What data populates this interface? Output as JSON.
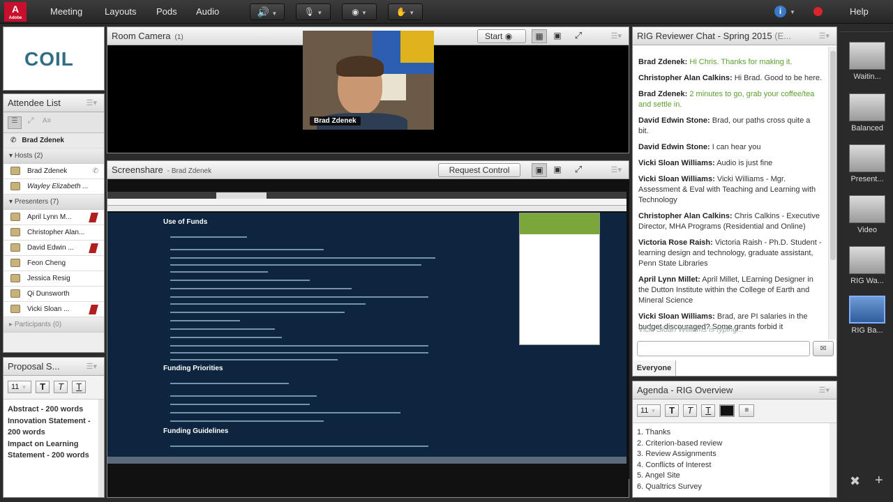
{
  "menubar": {
    "app_logo": "Adobe",
    "items": [
      "Meeting",
      "Layouts",
      "Pods",
      "Audio"
    ],
    "help": "Help"
  },
  "logo_pod": {
    "text": "COIL"
  },
  "attendee": {
    "title": "Attendee List",
    "current_user": "Brad Zdenek",
    "hosts_label": "Hosts (2)",
    "hosts": [
      "Brad Zdenek",
      "Wayley Elizabeth ..."
    ],
    "presenters_label": "Presenters (7)",
    "presenters": [
      "April Lynn M...",
      "Christopher Alan...",
      "David Edwin ...",
      "Feon Cheng",
      "Jessica Resig",
      "Qi Dunsworth",
      "Vicki Sloan ..."
    ],
    "participants_label": "Participants (0)"
  },
  "proposal": {
    "title": "Proposal S...",
    "font_size": "11",
    "text": [
      "Abstract - 200 words",
      "Innovation Statement - 200 words",
      "Impact on Learning Statement - 200 words"
    ]
  },
  "camera": {
    "title": "Room Camera",
    "count": "(1)",
    "start_label": "Start",
    "name_tag": "Brad Zdenek"
  },
  "screenshare": {
    "title": "Screenshare",
    "presenter": "- Brad Zdenek",
    "request_label": "Request Control",
    "doc": {
      "h1": "Use of Funds",
      "h2": "Funding Priorities",
      "h3": "Funding Guidelines"
    }
  },
  "chat": {
    "title": "RIG Reviewer Chat - Spring 2015",
    "title_suffix": "(E...",
    "messages": [
      {
        "name": "Brad Zdenek:",
        "text": "Hi Chris. Thanks for making it.",
        "green": true
      },
      {
        "name": "Christopher Alan Calkins:",
        "text": "Hi Brad.  Good to be here.",
        "green": false
      },
      {
        "name": "Brad Zdenek:",
        "text": "2 minutes to go, grab your coffee/tea and settle in.",
        "green": true
      },
      {
        "name": "David Edwin Stone:",
        "text": "Brad, our paths cross quite a bit.",
        "green": false
      },
      {
        "name": "David Edwin Stone:",
        "text": "I can hear you",
        "green": false
      },
      {
        "name": "Vicki Sloan Williams:",
        "text": "Audio is just fine",
        "green": false
      },
      {
        "name": "Vicki Sloan Williams:",
        "text": "Vicki Williams - Mgr. Assessment & Eval with Teaching and Learning with Technology",
        "green": false
      },
      {
        "name": "Christopher Alan Calkins:",
        "text": "Chris Calkins - Executive Director, MHA Programs (Residential and Online)",
        "green": false
      },
      {
        "name": "Victoria Rose Raish:",
        "text": "Victoria Raish - Ph.D. Student - learning design and technology, graduate assistant, Penn State Libraries",
        "green": false
      },
      {
        "name": "April Lynn Millet:",
        "text": "April Millet, LEarning Designer in the Dutton Institute within the College of Earth and Mineral Science",
        "green": false
      },
      {
        "name": "Vicki Sloan Williams:",
        "text": "Brad, are PI salaries in the budget discouraged? Some grants forbid it",
        "green": false
      }
    ],
    "typing": "Vicki Sloan Williams is typing...",
    "input_value": "",
    "recipient": "Everyone"
  },
  "agenda": {
    "title": "Agenda - RIG Overview",
    "font_size": "11",
    "items": [
      "1. Thanks",
      "2. Criterion-based review",
      "3. Review Assignments",
      "4. Conflicts of Interest",
      "5. Angel Site",
      "6. Qualtrics Survey"
    ]
  },
  "layouts": {
    "items": [
      "Waitin...",
      "Balanced",
      "Present...",
      "Video",
      "RIG Wa...",
      "RIG Ba..."
    ]
  }
}
